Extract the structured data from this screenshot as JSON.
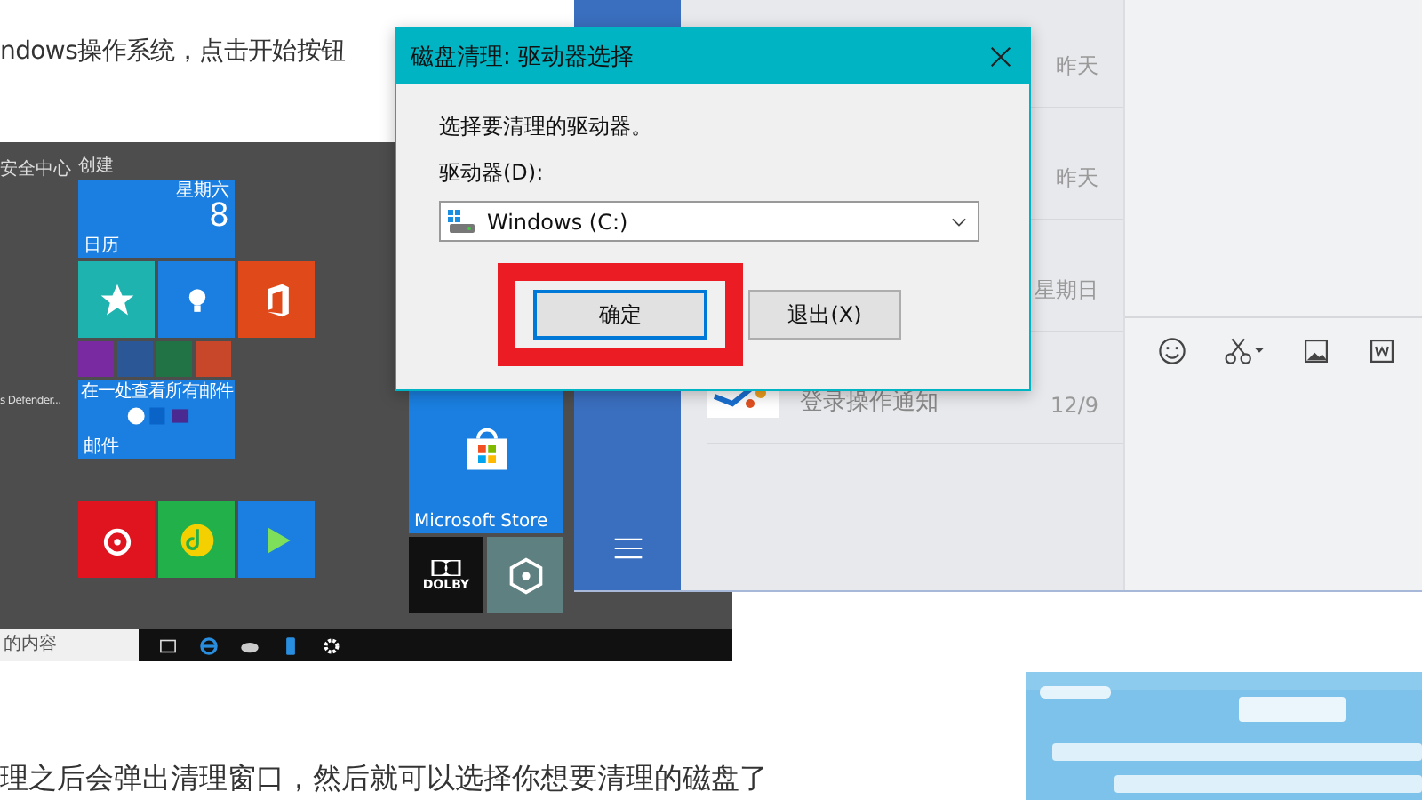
{
  "article": {
    "intro_text": "ndows操作系统，点击开始按钮",
    "caption_text": "理之后会弹出清理窗口，然后就可以选择你想要清理的磁盘了"
  },
  "start_menu": {
    "left_items": [
      "安全中心",
      "s Defender..."
    ],
    "group_title": "创建",
    "calendar": {
      "weekday": "星期六",
      "day": "8",
      "label": "日历"
    },
    "mail": {
      "caption": "在一处查看所有邮件",
      "label": "邮件"
    },
    "tiles": [
      {
        "kind": "star",
        "color": "#1fb3b0"
      },
      {
        "kind": "bulb",
        "color": "#1a7fe0"
      },
      {
        "kind": "office",
        "color": "#e04a1a"
      },
      {
        "kind": "netease",
        "color": "#e0141e"
      },
      {
        "kind": "qqmusic",
        "color": "#22b04a"
      },
      {
        "kind": "video",
        "color": "#1a7fe0"
      }
    ],
    "store": {
      "label": "Microsoft Store"
    },
    "dolby": {
      "label": "DOLBY"
    },
    "taskbar": {
      "search_text": "的内容"
    }
  },
  "chat": {
    "rows": [
      {
        "time": "昨天"
      },
      {
        "time": "昨天"
      },
      {
        "time": "星期日"
      },
      {
        "title": "登录操作通知",
        "time": "12/9"
      }
    ]
  },
  "dialog": {
    "title": "磁盘清理: 驱动器选择",
    "prompt": "选择要清理的驱动器。",
    "drive_label": "驱动器(D):",
    "drive_value": "Windows (C:)",
    "buttons": [
      {
        "label": "确定",
        "focused": true
      },
      {
        "label": "退出(X)",
        "focused": false
      }
    ]
  }
}
